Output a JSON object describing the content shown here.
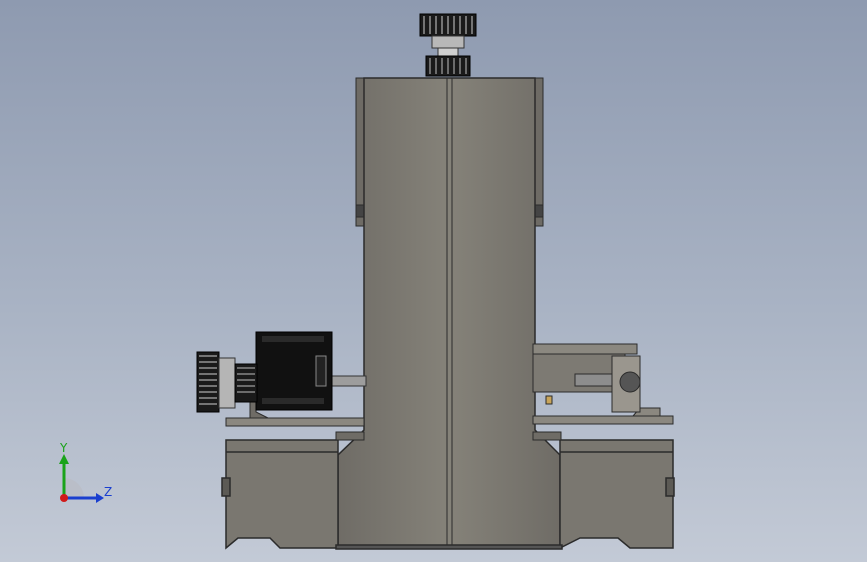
{
  "viewport": {
    "background_top": "#8e9ab0",
    "background_bottom": "#c3cad6"
  },
  "triad": {
    "y_label": "Y",
    "z_label": "Z",
    "y_color": "#1aa31a",
    "z_color": "#1a3fcf",
    "x_color": "#d01a1a"
  },
  "model": {
    "body_color": "#7b7871",
    "outline_color": "#2b2b2b",
    "motor_color": "#111111",
    "pulley_color": "#9a9a9a"
  }
}
